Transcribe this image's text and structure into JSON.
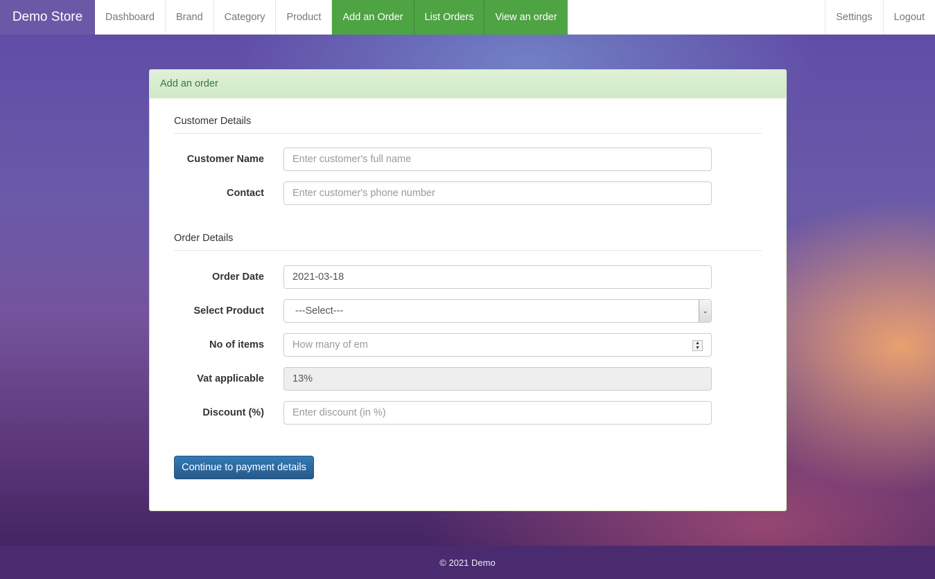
{
  "navbar": {
    "brand": "Demo Store",
    "left_items": [
      "Dashboard",
      "Brand",
      "Category",
      "Product"
    ],
    "active_items": [
      "Add an Order",
      "List Orders",
      "View an order"
    ],
    "right_items": [
      "Settings",
      "Logout"
    ],
    "active_color": "#4ea343",
    "brand_color": "#6b58a6"
  },
  "panel": {
    "heading": "Add an order",
    "customer_section": "Customer Details",
    "order_section": "Order Details",
    "fields": {
      "customer_name": {
        "label": "Customer Name",
        "placeholder": "Enter customer's full name"
      },
      "contact": {
        "label": "Contact",
        "placeholder": "Enter customer's phone number"
      },
      "order_date": {
        "label": "Order Date",
        "value": "2021-03-18"
      },
      "select_product": {
        "label": "Select Product",
        "value": "---Select---"
      },
      "no_of_items": {
        "label": "No of items",
        "placeholder": "How many of em"
      },
      "vat": {
        "label": "Vat applicable",
        "value": "13%"
      },
      "discount": {
        "label": "Discount (%)",
        "placeholder": "Enter discount (in %)"
      }
    },
    "submit_label": "Continue to payment details"
  },
  "footer": {
    "text": "© 2021 Demo"
  }
}
